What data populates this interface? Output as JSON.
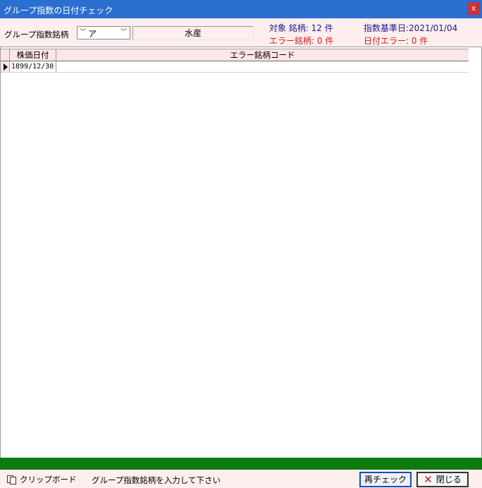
{
  "window": {
    "title": "グループ指数の日付チェック",
    "close_glyph": "x"
  },
  "header": {
    "group_label": "グループ指数銘柄",
    "combo_left_glyph": "﹀",
    "combo_value": "ア",
    "combo_right_glyph": "﹀",
    "group_name": "水産",
    "target_count": "対象 銘柄: 12 件",
    "error_count": "エラー銘柄: 0 件",
    "base_date": "指数基準日:2021/01/04",
    "date_error_count": "日付エラー: 0 件"
  },
  "grid": {
    "columns": [
      "株価日付",
      "エラー銘柄コード"
    ],
    "rows": [
      {
        "date": "1899/12/30",
        "code": ""
      }
    ]
  },
  "footer": {
    "clipboard_label": "クリップボード",
    "message": "グループ指数銘柄を入力して下さい",
    "recheck_label": "再チェック",
    "close_label": "閉じる",
    "close_glyph": "✕"
  },
  "colors": {
    "titlebar": "#2b6fd0",
    "header_bg": "#ffeeee",
    "progress": "#0f7a0f",
    "error_text": "#d02020",
    "info_text": "#1a1a8c"
  }
}
